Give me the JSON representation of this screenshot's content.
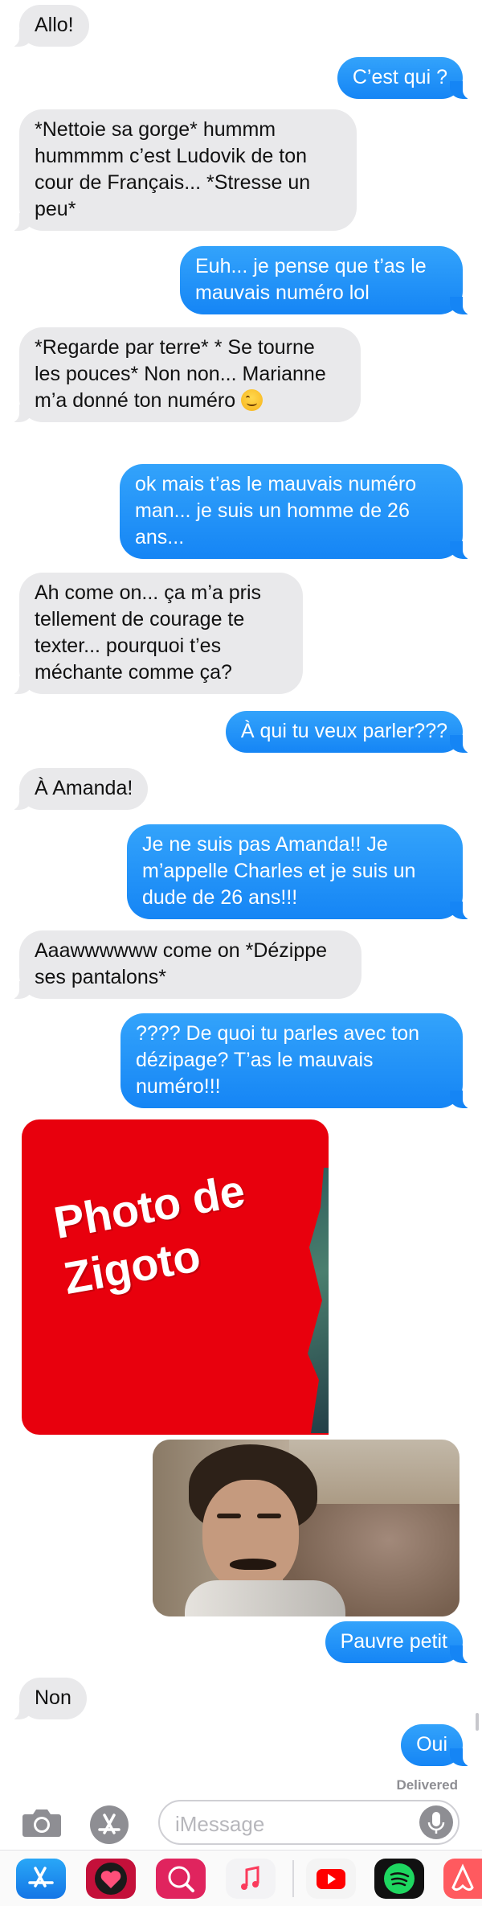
{
  "messages": [
    {
      "side": "in",
      "text": "Allo!"
    },
    {
      "side": "out",
      "text": "C’est qui ?"
    },
    {
      "side": "in",
      "text": "*Nettoie sa gorge* hummm hummmm c’est Ludovik de ton cour de Français... *Stresse un peu*"
    },
    {
      "side": "out",
      "text": "Euh... je pense que t’as le mauvais numéro lol"
    },
    {
      "side": "in",
      "text": "*Regarde par terre* * Se tourne les pouces* Non non... Marianne m’a donné ton numéro",
      "emoji": "smiling-face"
    },
    {
      "side": "out",
      "text": "ok mais t’as le mauvais numéro man... je suis un homme de 26 ans..."
    },
    {
      "side": "in",
      "text": "Ah come on... ça m’a pris tellement de courage te texter... pourquoi t’es méchante comme ça?"
    },
    {
      "side": "out",
      "text": "À qui tu veux parler???"
    },
    {
      "side": "in",
      "text": "À Amanda!"
    },
    {
      "side": "out",
      "text": "Je ne suis pas Amanda!! Je m’appelle Charles et je suis un dude de 26 ans!!!"
    },
    {
      "side": "in",
      "text": "Aaawwwwww come on *Dézippe ses pantalons*"
    },
    {
      "side": "out",
      "text": "???? De quoi tu parles avec ton dézipage? T’as le mauvais numéro!!!"
    },
    {
      "side": "out",
      "text": "Pauvre petit"
    },
    {
      "side": "in",
      "text": "Non"
    },
    {
      "side": "out",
      "text": "Oui"
    }
  ],
  "image_placeholder": {
    "line1": "Photo de",
    "line2": "Zigoto",
    "color": "#e8000d"
  },
  "status": {
    "delivered": "Delivered"
  },
  "composer": {
    "placeholder": "iMessage"
  },
  "colors": {
    "outgoing": "#1a8cf7",
    "incoming": "#e9e9eb"
  },
  "app_drawer": [
    "app-store-icon",
    "heart-app-icon",
    "search-globe-icon",
    "music-icon",
    "youtube-icon",
    "spotify-icon",
    "airbnb-icon"
  ]
}
